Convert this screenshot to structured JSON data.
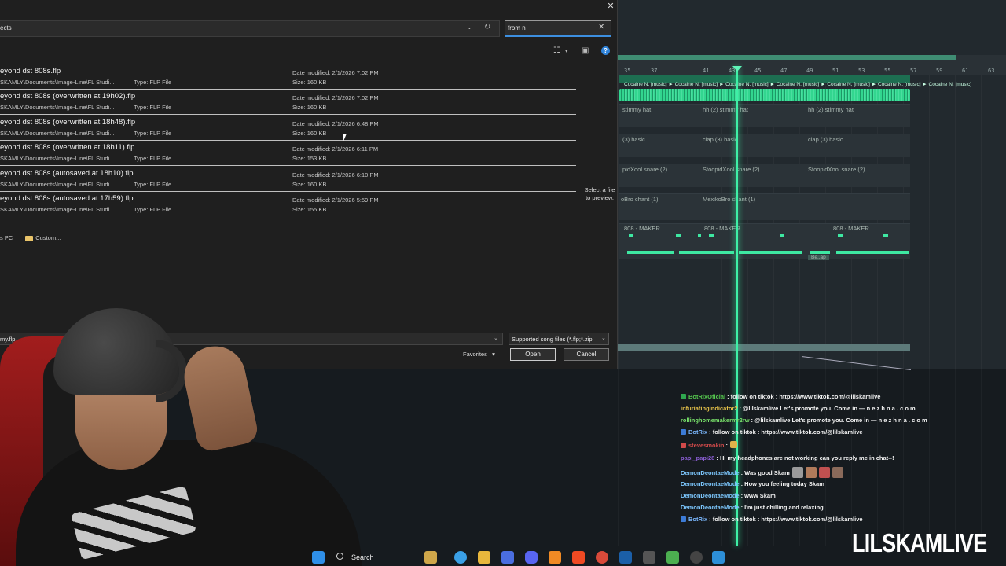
{
  "dialog": {
    "close_label": "✕",
    "address": "ects",
    "search_value": "from n",
    "preview_text": "Select a file to preview.",
    "locations": [
      {
        "label": "s PC"
      },
      {
        "label": "Custom..."
      }
    ],
    "filename_value": "my.flp",
    "filetype_value": "Supported song files (*.flp;*.zip;",
    "favorites_label": "Favorites",
    "open_label": "Open",
    "cancel_label": "Cancel",
    "files": [
      {
        "name": "eyond dst 808s.flp",
        "path": "SKAMLY\\Documents\\Image-Line\\FL Studi...",
        "type": "Type: FLP File",
        "date": "Date modified: 2/1/2026 7:02 PM",
        "size": "Size: 160 KB"
      },
      {
        "name": "eyond dst 808s (overwritten at 19h02).flp",
        "path": "SKAMLY\\Documents\\Image-Line\\FL Studi...",
        "type": "Type: FLP File",
        "date": "Date modified: 2/1/2026 7:02 PM",
        "size": "Size: 160 KB"
      },
      {
        "name": "eyond dst 808s (overwritten at 18h48).flp",
        "path": "SKAMLY\\Documents\\Image-Line\\FL Studi...",
        "type": "Type: FLP File",
        "date": "Date modified: 2/1/2026 6:48 PM",
        "size": "Size: 160 KB"
      },
      {
        "name": "eyond dst 808s (overwritten at 18h11).flp",
        "path": "SKAMLY\\Documents\\Image-Line\\FL Studi...",
        "type": "Type: FLP File",
        "date": "Date modified: 2/1/2026 6:11 PM",
        "size": "Size: 153 KB"
      },
      {
        "name": "eyond dst 808s (autosaved at 18h10).flp",
        "path": "SKAMLY\\Documents\\Image-Line\\FL Studi...",
        "type": "Type: FLP File",
        "date": "Date modified: 2/1/2026 6:10 PM",
        "size": "Size: 160 KB"
      },
      {
        "name": "eyond dst 808s (autosaved at 17h59).flp",
        "path": "SKAMLY\\Documents\\Image-Line\\FL Studi...",
        "type": "Type: FLP File",
        "date": "Date modified: 2/1/2026 5:59 PM",
        "size": "Size: 155 KB"
      }
    ]
  },
  "playlist": {
    "ruler_numbers": [
      "35",
      "37",
      "41",
      "43",
      "45",
      "47",
      "49",
      "51",
      "53",
      "55",
      "57",
      "59",
      "61",
      "63"
    ],
    "music_clip_label": "Cocaine N. [music] ► Cocaine N. [music] ► Cocaine N. [music] ► Cocaine N. [music] ► Cocaine N. [music] ► Cocaine N. [music] ► Cocaine N. [music]",
    "tracks": [
      {
        "labels": [
          "stimmy hat",
          "hh (2) stimmy hat",
          "hh (2) stimmy hat"
        ]
      },
      {
        "labels": [
          "(3) basic",
          "clap (3) basic",
          "clap (3) basic"
        ]
      },
      {
        "labels": [
          "pidXool snare (2)",
          "StoopidXool snare (2)",
          "StoopidXool snare (2)"
        ]
      },
      {
        "labels": [
          "oBro chant (1)",
          "MexikoBro chant (1)"
        ]
      },
      {
        "labels": [
          "808 - MAKER",
          "808 - MAKER",
          "808 - MAKER"
        ]
      }
    ],
    "small_clip_label": "Be..ap"
  },
  "chat": [
    {
      "user": "BotRixOficial",
      "user_color": "#56c94f",
      "message": ": follow on tiktok : https://www.tiktok.com/@lilskamlive",
      "badge_color": "#2fa84f"
    },
    {
      "user": "infuriatingindicator2",
      "user_color": "#e7c34a",
      "message": ": @lilskamlive Let's promote you. Come in — n e z h n a . c o m",
      "badge_color": ""
    },
    {
      "user": "rollinghomemakermr2rw",
      "user_color": "#79e36b",
      "message": ": @lilskamlive Let's promote you. Come in — n e z h n a . c o m",
      "badge_color": ""
    },
    {
      "user": "BotRix",
      "user_color": "#7bb8ff",
      "message": ": follow on tiktok : https://www.tiktok.com/@lilskamlive",
      "badge_color": "#3c7bd6"
    },
    {
      "user": "stevesmokin",
      "user_color": "#d04a4a",
      "message": ":",
      "badge_color": "#d04a4a"
    },
    {
      "user": "papi_papi28",
      "user_color": "#8c5fd6",
      "message": ": Hi my headphones are not working can you reply me in chat--!",
      "badge_color": ""
    },
    {
      "user": "DemonDeontaeMode",
      "user_color": "#7dc8ff",
      "message": ": Was good Skam",
      "badge_color": ""
    },
    {
      "user": "DemonDeontaeMode",
      "user_color": "#7dc8ff",
      "message": ": How you feeling today Skam",
      "badge_color": ""
    },
    {
      "user": "DemonDeontaeMode",
      "user_color": "#7dc8ff",
      "message": ": www Skam",
      "badge_color": ""
    },
    {
      "user": "DemonDeontaeMode",
      "user_color": "#7dc8ff",
      "message": ": I'm just chilling and relaxing",
      "badge_color": ""
    },
    {
      "user": "BotRix",
      "user_color": "#7bb8ff",
      "message": ": follow on tiktok : https://www.tiktok.com/@lilskamlive",
      "badge_color": "#3c7bd6"
    }
  ],
  "taskbar": {
    "search_label": "Search",
    "icons": [
      "windows-start-icon",
      "file-explorer-icon",
      "copilot-icon",
      "folder-icon",
      "store-icon",
      "discord-icon",
      "fl-studio-icon",
      "brave-icon",
      "chrome-icon",
      "steam-icon",
      "app-icon",
      "game-icon",
      "4k-icon",
      "photos-icon"
    ]
  },
  "watermark": "LILSKAMLIVE"
}
